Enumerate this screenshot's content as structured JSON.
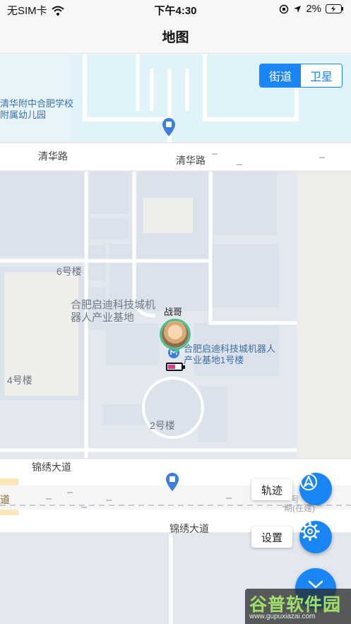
{
  "status_bar": {
    "carrier": "无SIM卡",
    "time": "下午4:30",
    "battery_percent": "2%",
    "icons": [
      "wifi-icon",
      "orientation-lock-icon",
      "location-arrow-icon",
      "battery-charging-icon"
    ]
  },
  "nav": {
    "title": "地图"
  },
  "map": {
    "mode_toggle": {
      "options": [
        "街道",
        "卫星"
      ],
      "selected": "街道"
    },
    "poi_labels": {
      "kindergarten": "清华附中合肥学校附属幼儿园",
      "park": "合肥启迪科技城机器人产业基地",
      "building1": "合肥启迪科技城机器人产业基地1号楼"
    },
    "building_labels": {
      "b6": "6号楼",
      "b4": "4号楼",
      "b2": "2号楼"
    },
    "road_labels": {
      "qinghua_left": "清华路",
      "qinghua_right": "清华路",
      "jinxiu_upper": "锦绣大道",
      "jinxiu_lower": "锦绣大道"
    },
    "partial_labels": {
      "left_edge": "道",
      "construction": "期(在建)",
      "construction_top": "号"
    },
    "user": {
      "name": "战哥",
      "battery_level": 0.5,
      "battery_color": "#e23a8a",
      "ring_color": "#49c18b"
    }
  },
  "controls": {
    "track_button": "轨迹",
    "settings_button": "设置",
    "icons": [
      "navigate-arrow-icon",
      "settings-gear-icon",
      "expand-chevron-icon"
    ]
  },
  "watermark": {
    "title": "谷普软件园",
    "url": "www.gupuxiazai.com"
  },
  "colors": {
    "accent": "#1a86f5",
    "map_block": "#dde3ec",
    "water": "#dff3f9"
  }
}
